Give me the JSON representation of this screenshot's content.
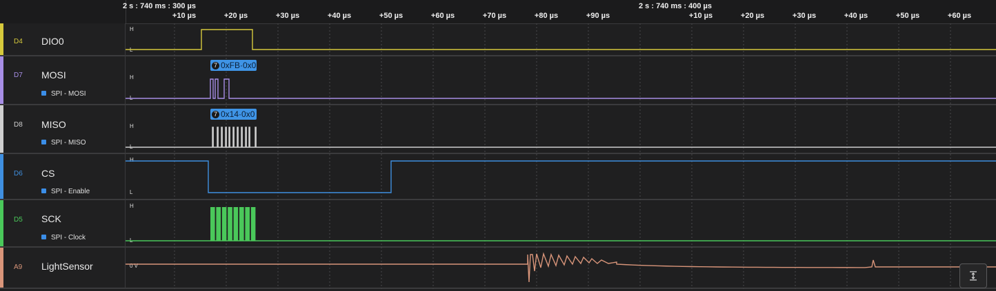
{
  "timebar": {
    "abs_left": "2 s : 740 ms : 300 µs",
    "abs_right": "2 s : 740 ms : 400 µs",
    "ticks_first": [
      "+10 µs",
      "+20 µs",
      "+30 µs",
      "+40 µs",
      "+50 µs",
      "+60 µs",
      "+70 µs",
      "+80 µs",
      "+90 µs"
    ],
    "ticks_second": [
      "+10 µs",
      "+20 µs",
      "+30 µs",
      "+40 µs",
      "+50 µs",
      "+60 µs"
    ]
  },
  "channels": [
    {
      "id": "D4",
      "name": "DIO0",
      "color": "#d6c93c"
    },
    {
      "id": "D7",
      "name": "MOSI",
      "color": "#a78ee6",
      "analyzer": "SPI - MOSI"
    },
    {
      "id": "D8",
      "name": "MISO",
      "color": "#cfcfcf",
      "analyzer": "SPI - MISO"
    },
    {
      "id": "D6",
      "name": "CS",
      "color": "#3f8fe0",
      "analyzer": "SPI - Enable"
    },
    {
      "id": "D5",
      "name": "SCK",
      "color": "#4ac85a",
      "analyzer": "SPI - Clock"
    },
    {
      "id": "A9",
      "name": "LightSensor",
      "color": "#d9957a"
    }
  ],
  "levels": {
    "high": "H",
    "low": "L",
    "zero": "0 V"
  },
  "decoded": {
    "mosi": {
      "count": "7",
      "text": "0xFB·0x0"
    },
    "miso": {
      "count": "7",
      "text": "0x14·0x0"
    }
  },
  "icons": {
    "scroll": "scroll-to-bottom-icon"
  }
}
